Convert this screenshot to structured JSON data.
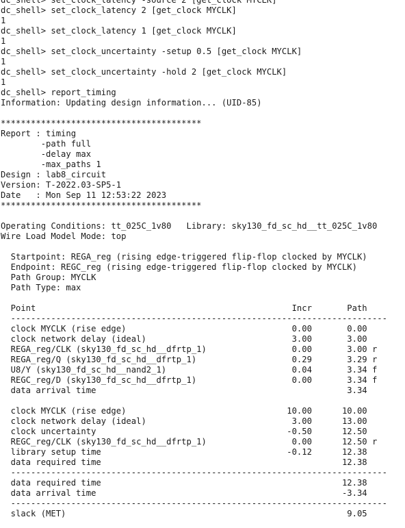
{
  "terminal": {
    "lines": [
      "dc_shell> set_clock_latency -source 2 [get_clock MYCLK]",
      "dc_shell> set_clock_latency 2 [get_clock MYCLK]",
      "1",
      "dc_shell> set_clock_latency 1 [get_clock MYCLK]",
      "1",
      "dc_shell> set_clock_uncertainty -setup 0.5 [get_clock MYCLK]",
      "1",
      "dc_shell> set_clock_uncertainty -hold 2 [get_clock MYCLK]",
      "1",
      "dc_shell> report_timing",
      "Information: Updating design information... (UID-85)",
      "",
      "****************************************",
      "Report : timing",
      "        -path full",
      "        -delay max",
      "        -max_paths 1",
      "Design : lab8_circuit",
      "Version: T-2022.03-SP5-1",
      "Date   : Mon Sep 11 12:53:22 2023",
      "****************************************",
      "",
      "Operating Conditions: tt_025C_1v80   Library: sky130_fd_sc_hd__tt_025C_1v80",
      "Wire Load Model Mode: top",
      "",
      "  Startpoint: REGA_reg (rising edge-triggered flip-flop clocked by MYCLK)",
      "  Endpoint: REGC_reg (rising edge-triggered flip-flop clocked by MYCLK)",
      "  Path Group: MYCLK",
      "  Path Type: max",
      "",
      "  Point                                                   Incr       Path",
      "  ---------------------------------------------------------------------------",
      "  clock MYCLK (rise edge)                                 0.00       0.00",
      "  clock network delay (ideal)                             3.00       3.00",
      "  REGA_reg/CLK (sky130_fd_sc_hd__dfrtp_1)                 0.00       3.00 r",
      "  REGA_reg/Q (sky130_fd_sc_hd__dfrtp_1)                   0.29       3.29 r",
      "  U8/Y (sky130_fd_sc_hd__nand2_1)                         0.04       3.34 f",
      "  REGC_reg/D (sky130_fd_sc_hd__dfrtp_1)                   0.00       3.34 f",
      "  data arrival time                                                  3.34",
      "",
      "  clock MYCLK (rise edge)                                10.00      10.00",
      "  clock network delay (ideal)                             3.00      13.00",
      "  clock uncertainty                                      -0.50      12.50",
      "  REGC_reg/CLK (sky130_fd_sc_hd__dfrtp_1)                 0.00      12.50 r",
      "  library setup time                                     -0.12      12.38",
      "  data required time                                                12.38",
      "  ---------------------------------------------------------------------------",
      "  data required time                                                12.38",
      "  data arrival time                                                 -3.34",
      "  ---------------------------------------------------------------------------",
      "  slack (MET)                                                        9.05"
    ]
  }
}
